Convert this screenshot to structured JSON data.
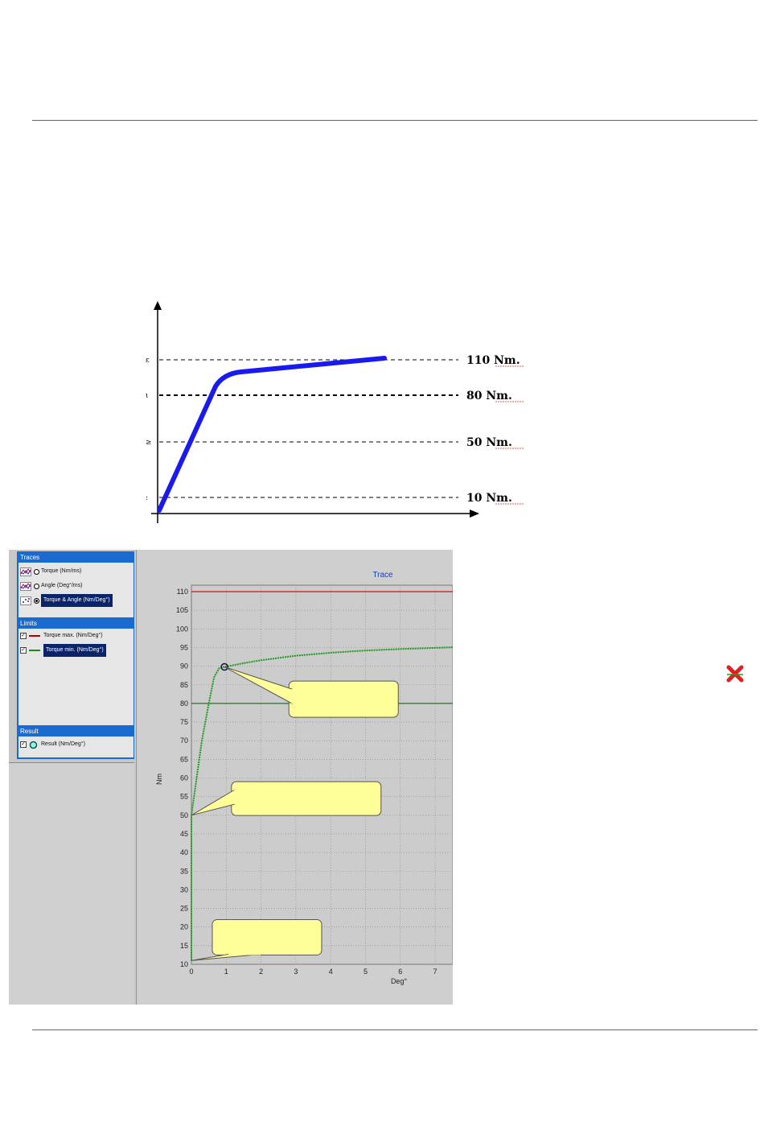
{
  "schematic": {
    "levels": [
      {
        "label": "110 Nm."
      },
      {
        "label": "80 Nm."
      },
      {
        "label": "50 Nm."
      },
      {
        "label": "10 Nm."
      }
    ]
  },
  "sidebar": {
    "traces_title": "Traces",
    "traces": [
      {
        "label": "Torque (Nm/ms)",
        "selected": false
      },
      {
        "label": "Angle (Deg°/ms)",
        "selected": false
      },
      {
        "label": "Torque & Angle (Nm/Deg°)",
        "selected": true
      }
    ],
    "limits_title": "Limits",
    "limits": [
      {
        "label": "Torque max. (Nm/Deg°)",
        "color": "#b00000",
        "checked": true
      },
      {
        "label": "Torque min. (Nm/Deg°)",
        "color": "#1a8a1a",
        "checked": true
      }
    ],
    "result_title": "Result",
    "result": {
      "label": "Result (Nm/Deg°)",
      "checked": true
    }
  },
  "chart_data": {
    "type": "line",
    "title": "Trace",
    "xlabel": "Deg°",
    "ylabel": "Nm",
    "xlim": [
      0,
      7.6
    ],
    "ylim": [
      10,
      110
    ],
    "x_ticks": [
      0,
      1,
      2,
      3,
      4,
      5,
      6,
      7
    ],
    "y_ticks": [
      10,
      15,
      20,
      25,
      30,
      35,
      40,
      45,
      50,
      55,
      60,
      65,
      70,
      75,
      80,
      85,
      90,
      95,
      100,
      105,
      110
    ],
    "grid": true,
    "series": [
      {
        "name": "Torque max. (Nm/Deg°)",
        "color": "#c01818",
        "x": [
          0,
          7.6
        ],
        "y": [
          110,
          110
        ]
      },
      {
        "name": "Torque min. (Nm/Deg°)",
        "color": "#1a7a1a",
        "x": [
          0,
          7.6
        ],
        "y": [
          80,
          80
        ]
      },
      {
        "name": "Result (Nm/Deg°)",
        "color": "#1e9a1e",
        "x": [
          0,
          0,
          0,
          0.15,
          0.3,
          0.5,
          0.65,
          0.8,
          0.95,
          1.5,
          2,
          3,
          4,
          5,
          6,
          7,
          7.6
        ],
        "y": [
          11,
          30,
          50,
          60,
          70,
          80,
          87,
          89.5,
          89.8,
          90.8,
          91.6,
          92.8,
          93.6,
          94.2,
          94.6,
          94.9,
          95.1
        ]
      }
    ],
    "marker": {
      "x": 0.95,
      "y": 89.8
    },
    "callouts": [
      {
        "box": [
          2.8,
          86
        ],
        "tip": [
          0.95,
          89.8
        ]
      },
      {
        "box": [
          1.15,
          59
        ],
        "tip": [
          0,
          50
        ]
      },
      {
        "box": [
          0.6,
          22
        ],
        "tip": [
          0,
          11
        ]
      }
    ]
  },
  "icons": {
    "close": "close-icon"
  }
}
